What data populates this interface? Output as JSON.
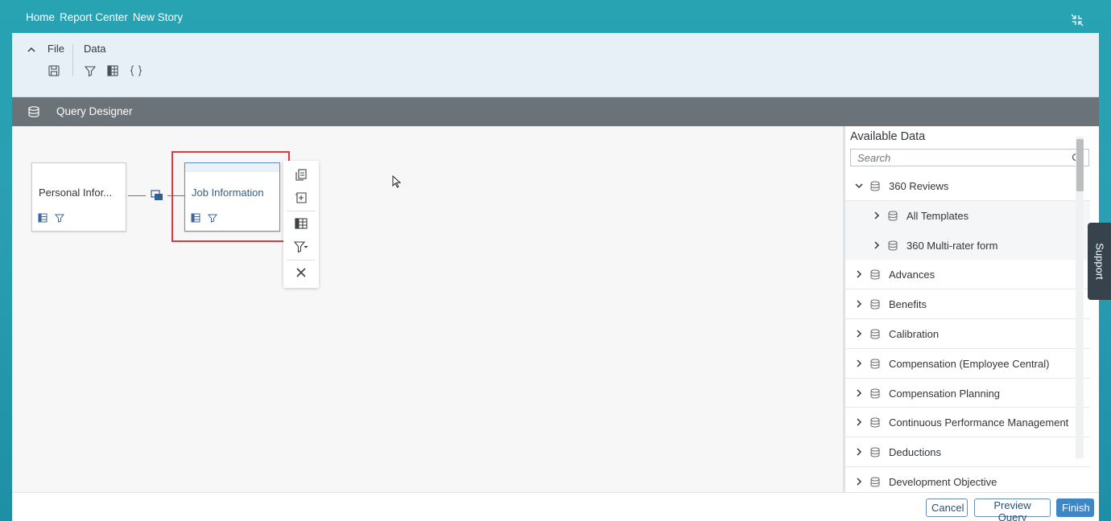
{
  "breadcrumb": [
    "Home",
    "Report Center",
    "New Story"
  ],
  "toolbar": {
    "tabs": [
      "File",
      "Data"
    ],
    "icons": [
      "save-icon",
      "filter-icon",
      "table-icon",
      "braces-icon"
    ]
  },
  "query_designer": {
    "title": "Query Designer"
  },
  "canvas": {
    "nodes": [
      {
        "label": "Personal Infor...",
        "selected": false
      },
      {
        "label": "Job Information",
        "selected": true
      }
    ],
    "node_menu_icons": [
      "duplicate-icon",
      "add-related-icon",
      "columns-icon",
      "filter-dropdown-icon",
      "close-icon"
    ]
  },
  "available_data": {
    "title": "Available Data",
    "search_placeholder": "Search",
    "items": [
      {
        "label": "360 Reviews",
        "expanded": true,
        "level": 0
      },
      {
        "label": "All Templates",
        "expanded": false,
        "level": 1
      },
      {
        "label": "360 Multi-rater form",
        "expanded": false,
        "level": 1
      },
      {
        "label": "Advances",
        "expanded": false,
        "level": 0
      },
      {
        "label": "Benefits",
        "expanded": false,
        "level": 0
      },
      {
        "label": "Calibration",
        "expanded": false,
        "level": 0
      },
      {
        "label": "Compensation (Employee Central)",
        "expanded": false,
        "level": 0
      },
      {
        "label": "Compensation Planning",
        "expanded": false,
        "level": 0
      },
      {
        "label": "Continuous Performance Management",
        "expanded": false,
        "level": 0
      },
      {
        "label": "Deductions",
        "expanded": false,
        "level": 0
      },
      {
        "label": "Development Objective",
        "expanded": false,
        "level": 0
      }
    ]
  },
  "support": {
    "label": "Support"
  },
  "footer": {
    "cancel": "Cancel",
    "preview": "Preview Query",
    "finish": "Finish"
  },
  "colors": {
    "accent": "#3e86c5",
    "header": "#6b7378",
    "highlight": "#e3383b",
    "teal": "#27a3b2"
  }
}
